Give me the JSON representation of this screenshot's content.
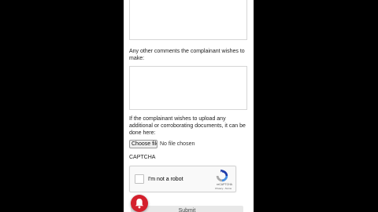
{
  "form": {
    "comments_label": "Any other comments the complainant wishes to make:",
    "upload_label": "If the complainant wishes to upload any additional or corroborating documents, it can be done here:",
    "file_button_label": "Choose file",
    "file_status": "No file chosen",
    "captcha_heading": "CAPTCHA",
    "submit_label": "Submit"
  },
  "recaptcha": {
    "checkbox_label": "I'm not a robot",
    "brand": "reCAPTCHA",
    "terms": "Privacy - Terms"
  },
  "icons": {
    "recaptcha": "recaptcha-icon",
    "notification": "bell-icon"
  },
  "colors": {
    "notify_button": "#d4202d"
  }
}
